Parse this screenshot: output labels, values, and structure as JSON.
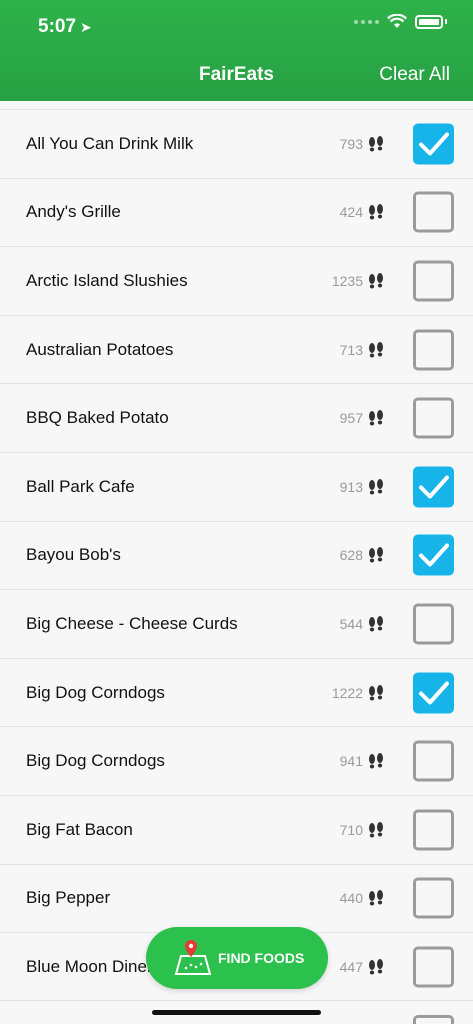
{
  "status": {
    "time": "5:07"
  },
  "header": {
    "title": "FairEats",
    "clear_label": "Clear All"
  },
  "items": [
    {
      "name": "All You Can Drink Milk",
      "steps": "793",
      "checked": true
    },
    {
      "name": "Andy's Grille",
      "steps": "424",
      "checked": false
    },
    {
      "name": "Arctic Island Slushies",
      "steps": "1235",
      "checked": false
    },
    {
      "name": "Australian Potatoes",
      "steps": "713",
      "checked": false
    },
    {
      "name": "BBQ Baked Potato",
      "steps": "957",
      "checked": false
    },
    {
      "name": "Ball Park Cafe",
      "steps": "913",
      "checked": true
    },
    {
      "name": "Bayou Bob's",
      "steps": "628",
      "checked": true
    },
    {
      "name": "Big Cheese - Cheese Curds",
      "steps": "544",
      "checked": false
    },
    {
      "name": "Big Dog Corndogs",
      "steps": "1222",
      "checked": true
    },
    {
      "name": "Big Dog Corndogs",
      "steps": "941",
      "checked": false
    },
    {
      "name": "Big Fat Bacon",
      "steps": "710",
      "checked": false
    },
    {
      "name": "Big Pepper",
      "steps": "440",
      "checked": false
    },
    {
      "name": "Blue Moon Diner",
      "steps": "447",
      "checked": false
    }
  ],
  "fab": {
    "label": "FIND FOODS",
    "icon": "map-pin-icon"
  },
  "colors": {
    "header": "#2fb24a",
    "checked": "#17b4ea",
    "fab": "#2cc14d"
  }
}
